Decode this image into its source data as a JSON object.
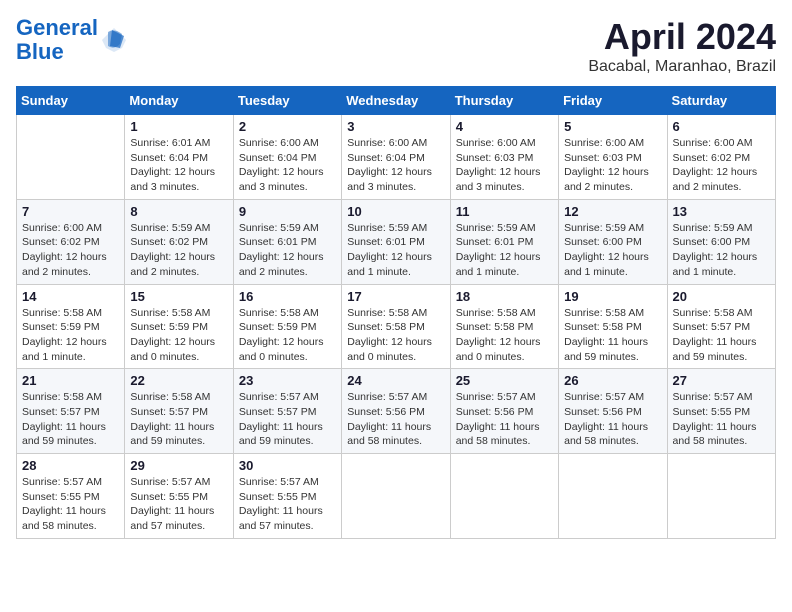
{
  "logo": {
    "line1": "General",
    "line2": "Blue"
  },
  "title": "April 2024",
  "subtitle": "Bacabal, Maranhao, Brazil",
  "days_of_week": [
    "Sunday",
    "Monday",
    "Tuesday",
    "Wednesday",
    "Thursday",
    "Friday",
    "Saturday"
  ],
  "weeks": [
    [
      {
        "day": "",
        "info": ""
      },
      {
        "day": "1",
        "info": "Sunrise: 6:01 AM\nSunset: 6:04 PM\nDaylight: 12 hours\nand 3 minutes."
      },
      {
        "day": "2",
        "info": "Sunrise: 6:00 AM\nSunset: 6:04 PM\nDaylight: 12 hours\nand 3 minutes."
      },
      {
        "day": "3",
        "info": "Sunrise: 6:00 AM\nSunset: 6:04 PM\nDaylight: 12 hours\nand 3 minutes."
      },
      {
        "day": "4",
        "info": "Sunrise: 6:00 AM\nSunset: 6:03 PM\nDaylight: 12 hours\nand 3 minutes."
      },
      {
        "day": "5",
        "info": "Sunrise: 6:00 AM\nSunset: 6:03 PM\nDaylight: 12 hours\nand 2 minutes."
      },
      {
        "day": "6",
        "info": "Sunrise: 6:00 AM\nSunset: 6:02 PM\nDaylight: 12 hours\nand 2 minutes."
      }
    ],
    [
      {
        "day": "7",
        "info": "Sunrise: 6:00 AM\nSunset: 6:02 PM\nDaylight: 12 hours\nand 2 minutes."
      },
      {
        "day": "8",
        "info": "Sunrise: 5:59 AM\nSunset: 6:02 PM\nDaylight: 12 hours\nand 2 minutes."
      },
      {
        "day": "9",
        "info": "Sunrise: 5:59 AM\nSunset: 6:01 PM\nDaylight: 12 hours\nand 2 minutes."
      },
      {
        "day": "10",
        "info": "Sunrise: 5:59 AM\nSunset: 6:01 PM\nDaylight: 12 hours\nand 1 minute."
      },
      {
        "day": "11",
        "info": "Sunrise: 5:59 AM\nSunset: 6:01 PM\nDaylight: 12 hours\nand 1 minute."
      },
      {
        "day": "12",
        "info": "Sunrise: 5:59 AM\nSunset: 6:00 PM\nDaylight: 12 hours\nand 1 minute."
      },
      {
        "day": "13",
        "info": "Sunrise: 5:59 AM\nSunset: 6:00 PM\nDaylight: 12 hours\nand 1 minute."
      }
    ],
    [
      {
        "day": "14",
        "info": "Sunrise: 5:58 AM\nSunset: 5:59 PM\nDaylight: 12 hours\nand 1 minute."
      },
      {
        "day": "15",
        "info": "Sunrise: 5:58 AM\nSunset: 5:59 PM\nDaylight: 12 hours\nand 0 minutes."
      },
      {
        "day": "16",
        "info": "Sunrise: 5:58 AM\nSunset: 5:59 PM\nDaylight: 12 hours\nand 0 minutes."
      },
      {
        "day": "17",
        "info": "Sunrise: 5:58 AM\nSunset: 5:58 PM\nDaylight: 12 hours\nand 0 minutes."
      },
      {
        "day": "18",
        "info": "Sunrise: 5:58 AM\nSunset: 5:58 PM\nDaylight: 12 hours\nand 0 minutes."
      },
      {
        "day": "19",
        "info": "Sunrise: 5:58 AM\nSunset: 5:58 PM\nDaylight: 11 hours\nand 59 minutes."
      },
      {
        "day": "20",
        "info": "Sunrise: 5:58 AM\nSunset: 5:57 PM\nDaylight: 11 hours\nand 59 minutes."
      }
    ],
    [
      {
        "day": "21",
        "info": "Sunrise: 5:58 AM\nSunset: 5:57 PM\nDaylight: 11 hours\nand 59 minutes."
      },
      {
        "day": "22",
        "info": "Sunrise: 5:58 AM\nSunset: 5:57 PM\nDaylight: 11 hours\nand 59 minutes."
      },
      {
        "day": "23",
        "info": "Sunrise: 5:57 AM\nSunset: 5:57 PM\nDaylight: 11 hours\nand 59 minutes."
      },
      {
        "day": "24",
        "info": "Sunrise: 5:57 AM\nSunset: 5:56 PM\nDaylight: 11 hours\nand 58 minutes."
      },
      {
        "day": "25",
        "info": "Sunrise: 5:57 AM\nSunset: 5:56 PM\nDaylight: 11 hours\nand 58 minutes."
      },
      {
        "day": "26",
        "info": "Sunrise: 5:57 AM\nSunset: 5:56 PM\nDaylight: 11 hours\nand 58 minutes."
      },
      {
        "day": "27",
        "info": "Sunrise: 5:57 AM\nSunset: 5:55 PM\nDaylight: 11 hours\nand 58 minutes."
      }
    ],
    [
      {
        "day": "28",
        "info": "Sunrise: 5:57 AM\nSunset: 5:55 PM\nDaylight: 11 hours\nand 58 minutes."
      },
      {
        "day": "29",
        "info": "Sunrise: 5:57 AM\nSunset: 5:55 PM\nDaylight: 11 hours\nand 57 minutes."
      },
      {
        "day": "30",
        "info": "Sunrise: 5:57 AM\nSunset: 5:55 PM\nDaylight: 11 hours\nand 57 minutes."
      },
      {
        "day": "",
        "info": ""
      },
      {
        "day": "",
        "info": ""
      },
      {
        "day": "",
        "info": ""
      },
      {
        "day": "",
        "info": ""
      }
    ]
  ]
}
